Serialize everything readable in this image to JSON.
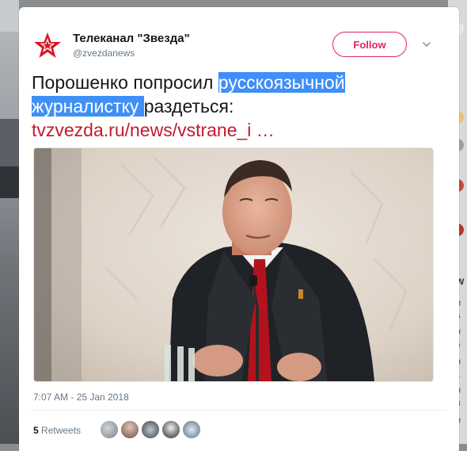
{
  "account": {
    "name": "Телеканал \"Звезда\"",
    "handle": "@zvezdanews",
    "logo_icon": "red-star-logo"
  },
  "follow_button": {
    "label": "Follow"
  },
  "tweet": {
    "line1_plain": "Порошенко попросил ",
    "line1_selected": "русскоязычной ",
    "line2_selected": "журналистку ",
    "line2_plain": "раздеться:",
    "link": "tvzvezda.ru/news/vstrane_i …"
  },
  "timestamp": "7:07 AM - 25 Jan 2018",
  "stats": {
    "retweets_count": "5",
    "retweets_label": "Retweets"
  },
  "colors": {
    "accent": "#e0245e",
    "link": "#c4182e",
    "selection": "#3f8ff6",
    "text": "#14171a",
    "muted": "#657786"
  }
}
